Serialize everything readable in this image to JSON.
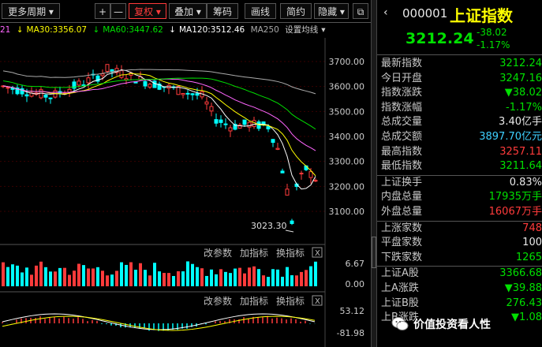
{
  "toolbar": {
    "period": "更多周期",
    "plus": "+",
    "minus": "—",
    "fuquan": "复权",
    "overlay": "叠加",
    "chip": "筹码",
    "draw": "画线",
    "simple": "简约",
    "hide": "隐藏"
  },
  "ma": {
    "ma20_prefix": "21",
    "ma30": "MA30:3356.07",
    "ma60": "MA60:3447.62",
    "ma120": "MA120:3512.46",
    "ma250": "MA250",
    "settings": "设置均线"
  },
  "axis": {
    "ticks": [
      "3700.00",
      "3600.00",
      "3500.00",
      "3400.00",
      "3300.00",
      "3200.00",
      "3100.00"
    ],
    "low_label": "3023.30",
    "vol_ticks": [
      "6.67",
      "0.00"
    ],
    "macd_ticks": [
      "53.12",
      "-81.98"
    ]
  },
  "subpanel": {
    "vol_links": [
      "改参数",
      "加指标",
      "换指标"
    ],
    "macd_links": [
      "改参数",
      "加指标",
      "换指标"
    ],
    "close": "X"
  },
  "quote": {
    "code": "000001",
    "name": "上证指数",
    "price": "3212.24",
    "change": "-38.02",
    "change_pct": "-1.17%"
  },
  "stats": [
    {
      "label": "最新指数",
      "value": "3212.24",
      "color": "green"
    },
    {
      "label": "今日开盘",
      "value": "3247.16",
      "color": "green"
    },
    {
      "label": "指数涨跌",
      "value": "▼38.02",
      "color": "green"
    },
    {
      "label": "指数涨幅",
      "value": "-1.17%",
      "color": "green"
    },
    {
      "label": "总成交量",
      "value": "3.40亿手",
      "color": "white"
    },
    {
      "label": "总成交额",
      "value": "3897.70亿元",
      "color": "cyan"
    },
    {
      "label": "最高指数",
      "value": "3257.11",
      "color": "red"
    },
    {
      "label": "最低指数",
      "value": "3211.64",
      "color": "green"
    },
    {
      "label": "上证换手",
      "value": "0.83%",
      "color": "white"
    },
    {
      "label": "内盘总量",
      "value": "17935万手",
      "color": "green"
    },
    {
      "label": "外盘总量",
      "value": "16067万手",
      "color": "red"
    },
    {
      "label": "上涨家数",
      "value": "748",
      "color": "red"
    },
    {
      "label": "平盘家数",
      "value": "100",
      "color": "white"
    },
    {
      "label": "下跌家数",
      "value": "1265",
      "color": "green"
    },
    {
      "label": "上证A股",
      "value": "3366.68",
      "color": "green"
    },
    {
      "label": "上A涨跌",
      "value": "▼39.88",
      "color": "green"
    },
    {
      "label": "上证B股",
      "value": "276.43",
      "color": "green"
    },
    {
      "label": "上B涨跌",
      "value": "▼1.08",
      "color": "green"
    }
  ],
  "watermark": "价值投资看人性",
  "colors": {
    "up": "#ff3b3b",
    "down": "#00e000",
    "bg": "#000000"
  }
}
